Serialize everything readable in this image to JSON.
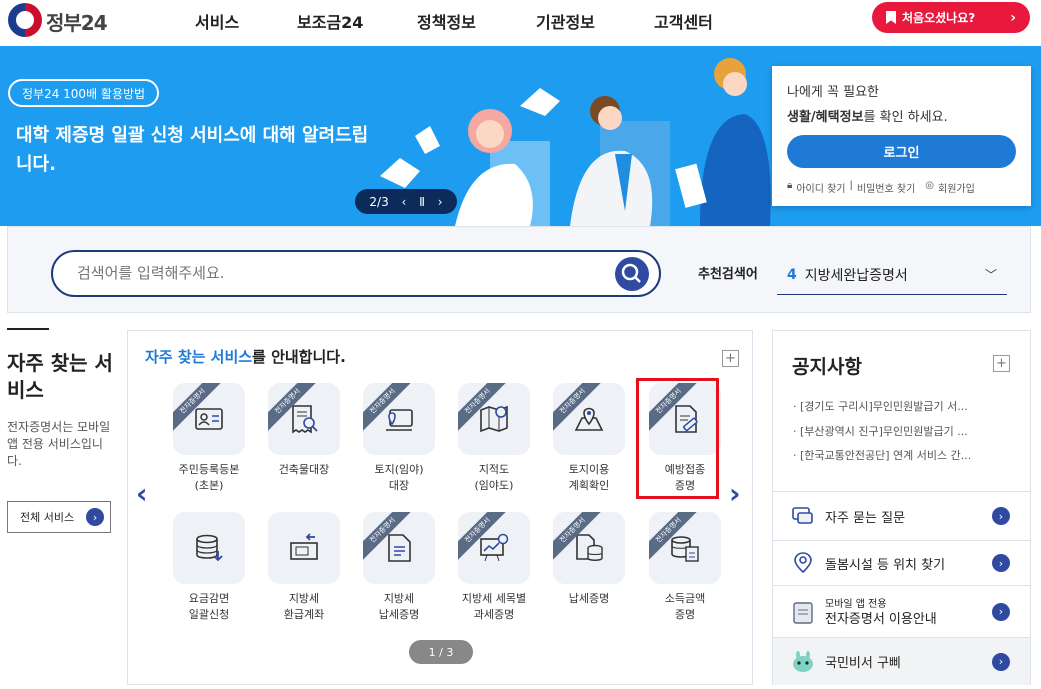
{
  "header": {
    "logo_text": "정부24",
    "nav": [
      "서비스",
      "보조금24",
      "정책정보",
      "기관정보",
      "고객센터"
    ],
    "first_visit_button": "처음오셨나요?"
  },
  "banner": {
    "pill": "정부24 100배 활용방법",
    "title": "대학 제증명 일괄 신청 서비스에 대해 알려드립니다.",
    "pager": "2/3"
  },
  "login": {
    "line1": "나에게 꼭 필요한",
    "line2_bold": "생활/혜택정보",
    "line2_rest": "를 확인 하세요.",
    "button": "로그인",
    "find_id": "아이디 찾기",
    "find_pw": "비밀번호 찾기",
    "join": "회원가입"
  },
  "search": {
    "placeholder": "검색어를 입력해주세요.",
    "rec_label": "추천검색어",
    "rec_num": "4",
    "rec_value": "지방세완납증명서"
  },
  "left": {
    "title": "자주 찾는 서비스",
    "desc": "전자증명서는 모바일 앱 전용 서비스입니다.",
    "all_button": "전체 서비스"
  },
  "services": {
    "title_highlight": "자주 찾는 서비스",
    "title_rest": "를 안내합니다.",
    "ribbon": "전자증명서",
    "items": [
      {
        "label1": "주민등록등본",
        "label2": "(초본)",
        "ribbon": true,
        "icon": "id-card-icon"
      },
      {
        "label1": "건축물대장",
        "label2": "",
        "ribbon": true,
        "icon": "building-ledger-icon"
      },
      {
        "label1": "토지(임야)",
        "label2": "대장",
        "ribbon": true,
        "icon": "land-ledger-icon"
      },
      {
        "label1": "지적도",
        "label2": "(임야도)",
        "ribbon": true,
        "icon": "map-icon"
      },
      {
        "label1": "토지이용",
        "label2": "계획확인",
        "ribbon": true,
        "icon": "land-plan-icon"
      },
      {
        "label1": "예방접종",
        "label2": "증명",
        "ribbon": true,
        "icon": "vaccination-icon"
      },
      {
        "label1": "요금감면",
        "label2": "일괄신청",
        "ribbon": false,
        "icon": "fee-reduction-icon"
      },
      {
        "label1": "지방세",
        "label2": "환급계좌",
        "ribbon": false,
        "icon": "refund-account-icon"
      },
      {
        "label1": "지방세",
        "label2": "납세증명",
        "ribbon": true,
        "icon": "tax-document-icon"
      },
      {
        "label1": "지방세 세목별",
        "label2": "과세증명",
        "ribbon": true,
        "icon": "tax-chart-icon"
      },
      {
        "label1": "납세증명",
        "label2": "",
        "ribbon": true,
        "icon": "tax-payment-icon"
      },
      {
        "label1": "소득금액",
        "label2": "증명",
        "ribbon": true,
        "icon": "income-icon"
      }
    ],
    "page": "1 / 3"
  },
  "notice": {
    "title": "공지사항",
    "items": [
      "[경기도 구리시]무인민원발급기 서...",
      "[부산광역시 진구]무인민원발급기 ...",
      "[한국교통안전공단] 연계 서비스 간..."
    ]
  },
  "quick": [
    {
      "label": "자주 묻는 질문",
      "sub": "",
      "icon": "faq-icon"
    },
    {
      "label": "돌봄시설 등 위치 찾기",
      "sub": "",
      "icon": "location-pin-icon"
    },
    {
      "label": "전자증명서 이용안내",
      "sub": "모바일 앱 전용",
      "icon": "mobile-certificate-icon"
    },
    {
      "label": "국민비서 구삐",
      "sub": "",
      "icon": "gubbi-mascot-icon"
    }
  ]
}
